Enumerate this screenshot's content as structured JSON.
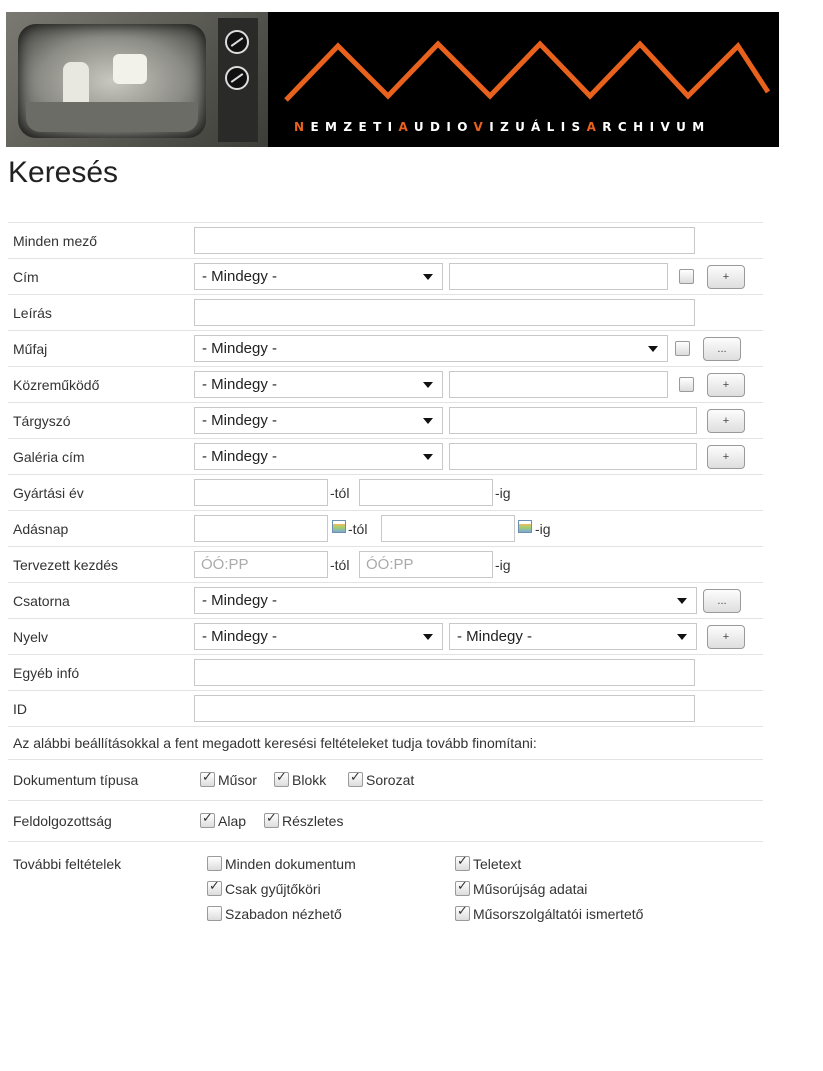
{
  "banner": {
    "brand_parts": [
      {
        "text": "N",
        "accent": true
      },
      {
        "text": "EMZETI",
        "accent": false
      },
      {
        "text": "A",
        "accent": true
      },
      {
        "text": "UDIO",
        "accent": false
      },
      {
        "text": "V",
        "accent": true
      },
      {
        "text": "IZUÁLIS",
        "accent": false
      },
      {
        "text": "A",
        "accent": true
      },
      {
        "text": "RCHIVUM",
        "accent": false
      }
    ],
    "accent_color": "#e8621e"
  },
  "page_title": "Keresés",
  "fields": {
    "all_fields": {
      "label": "Minden mező"
    },
    "title": {
      "label": "Cím",
      "select": "- Mindegy -",
      "add_button": "+"
    },
    "description": {
      "label": "Leírás"
    },
    "genre": {
      "label": "Műfaj",
      "select": "- Mindegy -",
      "more_button": "..."
    },
    "contributor": {
      "label": "Közreműködő",
      "select": "- Mindegy -",
      "add_button": "+"
    },
    "subject": {
      "label": "Tárgyszó",
      "select": "- Mindegy -",
      "add_button": "+"
    },
    "gallery_title": {
      "label": "Galéria cím",
      "select": "- Mindegy -",
      "add_button": "+"
    },
    "production_year": {
      "label": "Gyártási év",
      "from_suffix": "-tól",
      "to_suffix": "-ig"
    },
    "broadcast_day": {
      "label": "Adásnap",
      "from_suffix": "-tól",
      "to_suffix": "-ig"
    },
    "planned_start": {
      "label": "Tervezett kezdés",
      "placeholder": "ÓÓ:PP",
      "from_suffix": "-tól",
      "to_suffix": "-ig"
    },
    "channel": {
      "label": "Csatorna",
      "select": "- Mindegy -",
      "more_button": "..."
    },
    "language": {
      "label": "Nyelv",
      "select1": "- Mindegy -",
      "select2": "- Mindegy -",
      "add_button": "+"
    },
    "other_info": {
      "label": "Egyéb infó"
    },
    "id": {
      "label": "ID"
    }
  },
  "refine_note": "Az alábbi beállításokkal a fent megadott keresési feltételeket tudja tovább finomítani:",
  "doc_type": {
    "label": "Dokumentum típusa",
    "options": [
      {
        "label": "Műsor",
        "checked": true
      },
      {
        "label": "Blokk",
        "checked": true
      },
      {
        "label": "Sorozat",
        "checked": true
      }
    ]
  },
  "processing": {
    "label": "Feldolgozottság",
    "options": [
      {
        "label": "Alap",
        "checked": true
      },
      {
        "label": "Részletes",
        "checked": true
      }
    ]
  },
  "more_conditions": {
    "label": "További feltételek",
    "left": [
      {
        "label": "Minden dokumentum",
        "checked": false
      },
      {
        "label": "Csak gyűjtőköri",
        "checked": true
      },
      {
        "label": "Szabadon nézhető",
        "checked": false
      }
    ],
    "right": [
      {
        "label": "Teletext",
        "checked": true
      },
      {
        "label": "Műsorújság adatai",
        "checked": true
      },
      {
        "label": "Műsorszolgáltatói ismertető",
        "checked": true
      }
    ]
  }
}
